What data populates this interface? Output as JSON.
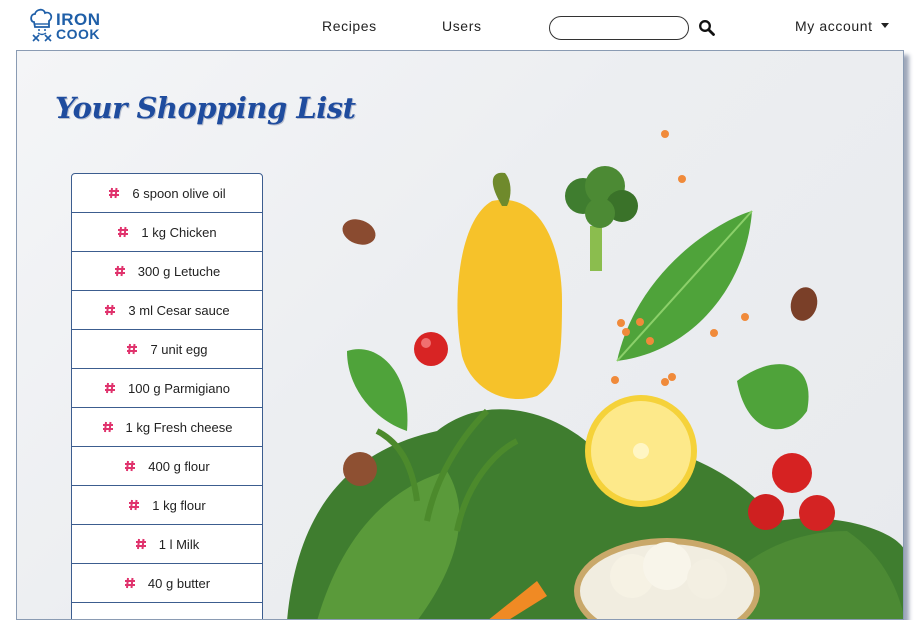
{
  "brand": {
    "line1": "IRON",
    "line2": "COOK"
  },
  "nav": {
    "recipes": "Recipes",
    "users": "Users",
    "account": "My account"
  },
  "search": {
    "value": "",
    "placeholder": ""
  },
  "page": {
    "title": "Your Shopping List"
  },
  "shopping_list": [
    "6 spoon olive oil",
    "1 kg Chicken",
    "300 g Letuche",
    "3 ml Cesar sauce",
    "7 unit egg",
    "100 g Parmigiano",
    "1 kg Fresh cheese",
    "400 g flour",
    "1 kg flour",
    "1 l Milk",
    "40 g butter",
    ""
  ],
  "icons": {
    "list_marker": "hashtag-icon",
    "search": "search-icon",
    "dropdown": "caret-down-icon",
    "logo": "chef-hat-icon"
  },
  "colors": {
    "brand": "#1f5fa8",
    "title": "#1f4c9e",
    "marker": "#e0336d",
    "list_border": "#3c5d8f"
  }
}
